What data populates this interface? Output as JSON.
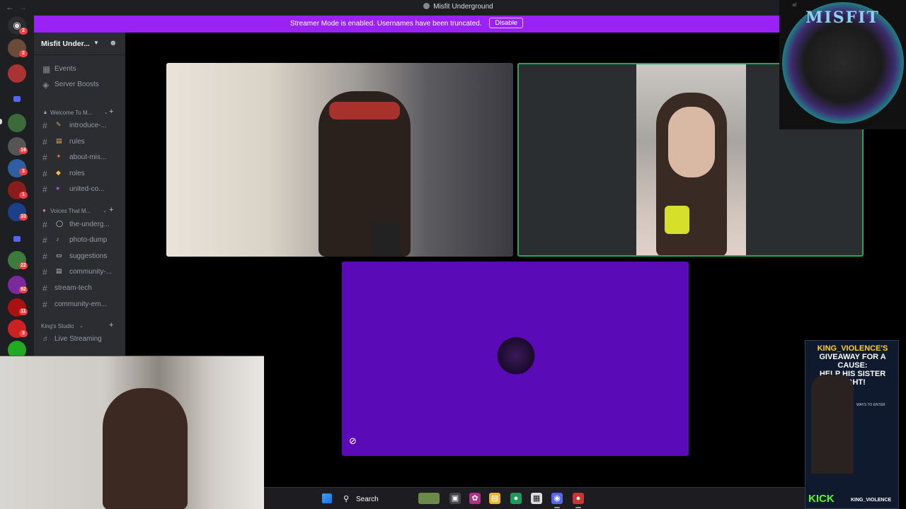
{
  "window": {
    "title": "Misfit Underground"
  },
  "banner": {
    "text": "Streamer Mode is enabled. Usernames have been truncated.",
    "button": "Disable"
  },
  "rail": {
    "badges": [
      "2",
      "2",
      "16",
      "3",
      "1",
      "33",
      "22",
      "92",
      "11",
      "3"
    ]
  },
  "sidebar": {
    "server_name": "Misfit Under...",
    "top_items": [
      {
        "icon": "calendar-icon",
        "label": "Events"
      },
      {
        "icon": "boost-icon",
        "label": "Server Boosts"
      }
    ],
    "categories": [
      {
        "label": "Welcome To M...",
        "channels": [
          "introduce-...",
          "rules",
          "about-mis...",
          "roles",
          "united-co..."
        ]
      },
      {
        "label": "Voices That M...",
        "channels": [
          "the-underg...",
          "photo-dump",
          "suggestions",
          "community-...",
          "stream-tech",
          "community-em..."
        ]
      },
      {
        "label": "King's Studio",
        "channels": [
          "Live Streaming"
        ]
      }
    ]
  },
  "overlay": {
    "logo_word": "MISFIT",
    "logo_corner": "al",
    "promo_title_top": "KING_VIOLENCE'S",
    "promo_title_mid": "GIVEAWAY FOR A CAUSE:",
    "promo_title_bot": "HELP HIS SISTER FIGHT!",
    "promo_ways": "WAYS TO ENTER",
    "promo_kick": "KICK",
    "promo_handle": "KING_VIOLENCE"
  },
  "taskbar": {
    "search": "Search"
  },
  "colors": {
    "banner": "#9b22f5",
    "speaking_border": "#23a55a",
    "tile_purple": "#5b0ab8"
  }
}
